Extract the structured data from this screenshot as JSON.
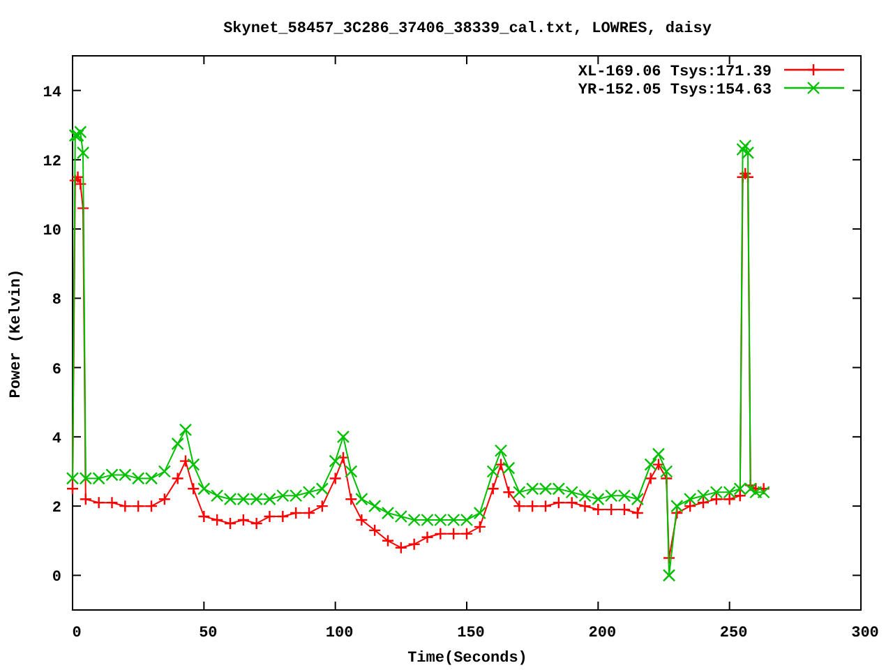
{
  "chart_data": {
    "type": "line",
    "title": "Skynet_58457_3C286_37406_38339_cal.txt, LOWRES, daisy",
    "xlabel": "Time(Seconds)",
    "ylabel": "Power (Kelvin)",
    "x": [
      0,
      1,
      2,
      3,
      4,
      5,
      10,
      15,
      20,
      25,
      30,
      35,
      40,
      43,
      46,
      50,
      55,
      60,
      65,
      70,
      75,
      80,
      85,
      90,
      95,
      100,
      103,
      106,
      110,
      115,
      120,
      125,
      130,
      135,
      140,
      145,
      150,
      155,
      160,
      163,
      166,
      170,
      175,
      180,
      185,
      190,
      195,
      200,
      205,
      210,
      215,
      220,
      223,
      226,
      227,
      230,
      235,
      240,
      245,
      250,
      254,
      255,
      256,
      257,
      258,
      260,
      263
    ],
    "series": [
      {
        "name": "XL-169.06 Tsys:171.39",
        "color": "#ff0000",
        "marker": "plus",
        "values": [
          2.5,
          11.4,
          11.5,
          11.3,
          10.6,
          2.2,
          2.1,
          2.1,
          2.0,
          2.0,
          2.0,
          2.2,
          2.8,
          3.3,
          2.5,
          1.7,
          1.6,
          1.5,
          1.6,
          1.5,
          1.7,
          1.7,
          1.8,
          1.8,
          2.0,
          2.8,
          3.4,
          2.2,
          1.6,
          1.3,
          1.0,
          0.8,
          0.9,
          1.1,
          1.2,
          1.2,
          1.2,
          1.4,
          2.5,
          3.2,
          2.4,
          2.0,
          2.0,
          2.0,
          2.1,
          2.1,
          2.0,
          1.9,
          1.9,
          1.9,
          1.8,
          2.8,
          3.2,
          2.8,
          0.5,
          1.8,
          2.0,
          2.1,
          2.2,
          2.2,
          2.3,
          11.5,
          11.6,
          11.5,
          2.6,
          2.5,
          2.5
        ]
      },
      {
        "name": "YR-152.05 Tsys:154.63",
        "color": "#00c000",
        "marker": "cross",
        "values": [
          2.8,
          12.7,
          12.7,
          12.8,
          12.2,
          2.8,
          2.8,
          2.9,
          2.9,
          2.8,
          2.8,
          3.0,
          3.8,
          4.2,
          3.2,
          2.5,
          2.3,
          2.2,
          2.2,
          2.2,
          2.2,
          2.3,
          2.3,
          2.4,
          2.5,
          3.3,
          4.0,
          3.0,
          2.2,
          2.0,
          1.8,
          1.7,
          1.6,
          1.6,
          1.6,
          1.6,
          1.6,
          1.8,
          3.0,
          3.6,
          3.1,
          2.4,
          2.5,
          2.5,
          2.5,
          2.4,
          2.3,
          2.2,
          2.3,
          2.3,
          2.2,
          3.2,
          3.5,
          3.0,
          0,
          2.0,
          2.2,
          2.3,
          2.4,
          2.4,
          2.5,
          12.3,
          12.4,
          12.2,
          2.5,
          2.4,
          2.4
        ]
      }
    ],
    "legend": "top-right",
    "xlim": [
      0,
      300
    ],
    "ylim": [
      -1,
      15
    ],
    "xticks": [
      0,
      50,
      100,
      150,
      200,
      250,
      300
    ],
    "yticks": [
      0,
      2,
      4,
      6,
      8,
      10,
      12,
      14
    ]
  }
}
